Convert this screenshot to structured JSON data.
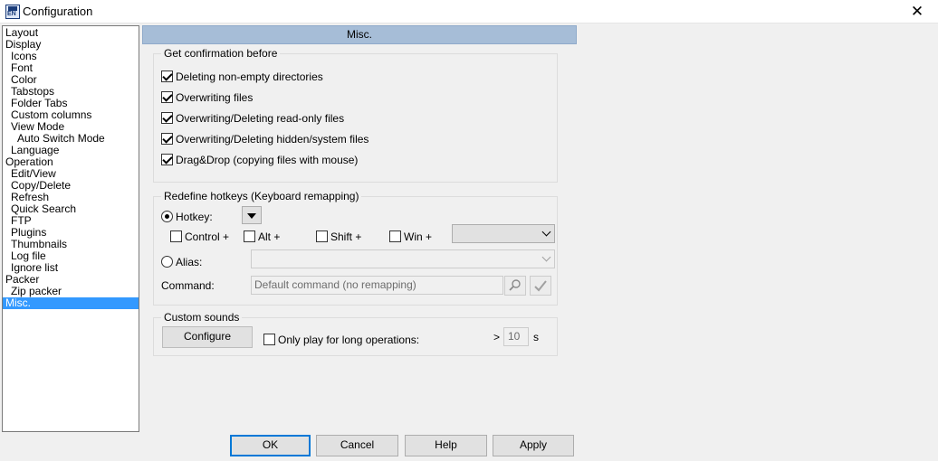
{
  "window": {
    "title": "Configuration",
    "close_glyph": "✕"
  },
  "tree": [
    {
      "label": "Layout",
      "level": 0
    },
    {
      "label": "Display",
      "level": 0
    },
    {
      "label": "Icons",
      "level": 1
    },
    {
      "label": "Font",
      "level": 1
    },
    {
      "label": "Color",
      "level": 1
    },
    {
      "label": "Tabstops",
      "level": 1
    },
    {
      "label": "Folder Tabs",
      "level": 1
    },
    {
      "label": "Custom columns",
      "level": 1
    },
    {
      "label": "View Mode",
      "level": 1
    },
    {
      "label": "Auto Switch Mode",
      "level": 2
    },
    {
      "label": "Language",
      "level": 1
    },
    {
      "label": "Operation",
      "level": 0
    },
    {
      "label": "Edit/View",
      "level": 1
    },
    {
      "label": "Copy/Delete",
      "level": 1
    },
    {
      "label": "Refresh",
      "level": 1
    },
    {
      "label": "Quick Search",
      "level": 1
    },
    {
      "label": "FTP",
      "level": 1
    },
    {
      "label": "Plugins",
      "level": 1
    },
    {
      "label": "Thumbnails",
      "level": 1
    },
    {
      "label": "Log file",
      "level": 1
    },
    {
      "label": "Ignore list",
      "level": 1
    },
    {
      "label": "Packer",
      "level": 0
    },
    {
      "label": "Zip packer",
      "level": 1
    },
    {
      "label": "Misc.",
      "level": 0,
      "selected": true
    }
  ],
  "header": {
    "title": "Misc."
  },
  "confirm": {
    "legend": "Get confirmation before",
    "items": [
      {
        "label": "Deleting non-empty directories",
        "checked": true
      },
      {
        "label": "Overwriting files",
        "checked": true
      },
      {
        "label": "Overwriting/Deleting read-only files",
        "checked": true
      },
      {
        "label": "Overwriting/Deleting hidden/system files",
        "checked": true
      },
      {
        "label": "Drag&Drop (copying files with mouse)",
        "checked": true
      }
    ]
  },
  "hotkeys": {
    "legend": "Redefine hotkeys (Keyboard remapping)",
    "hotkey_label": "Hotkey:",
    "control_label": "Control +",
    "alt_label": "Alt +",
    "shift_label": "Shift +",
    "win_label": "Win +",
    "alias_label": "Alias:",
    "command_label": "Command:",
    "command_value": "Default command (no remapping)"
  },
  "sounds": {
    "legend": "Custom sounds",
    "configure_label": "Configure",
    "long_ops_label": "Only play for long operations:",
    "gt_label": ">",
    "seconds_value": "10",
    "unit_label": "s"
  },
  "buttons": {
    "ok": "OK",
    "cancel": "Cancel",
    "help": "Help",
    "apply": "Apply"
  }
}
